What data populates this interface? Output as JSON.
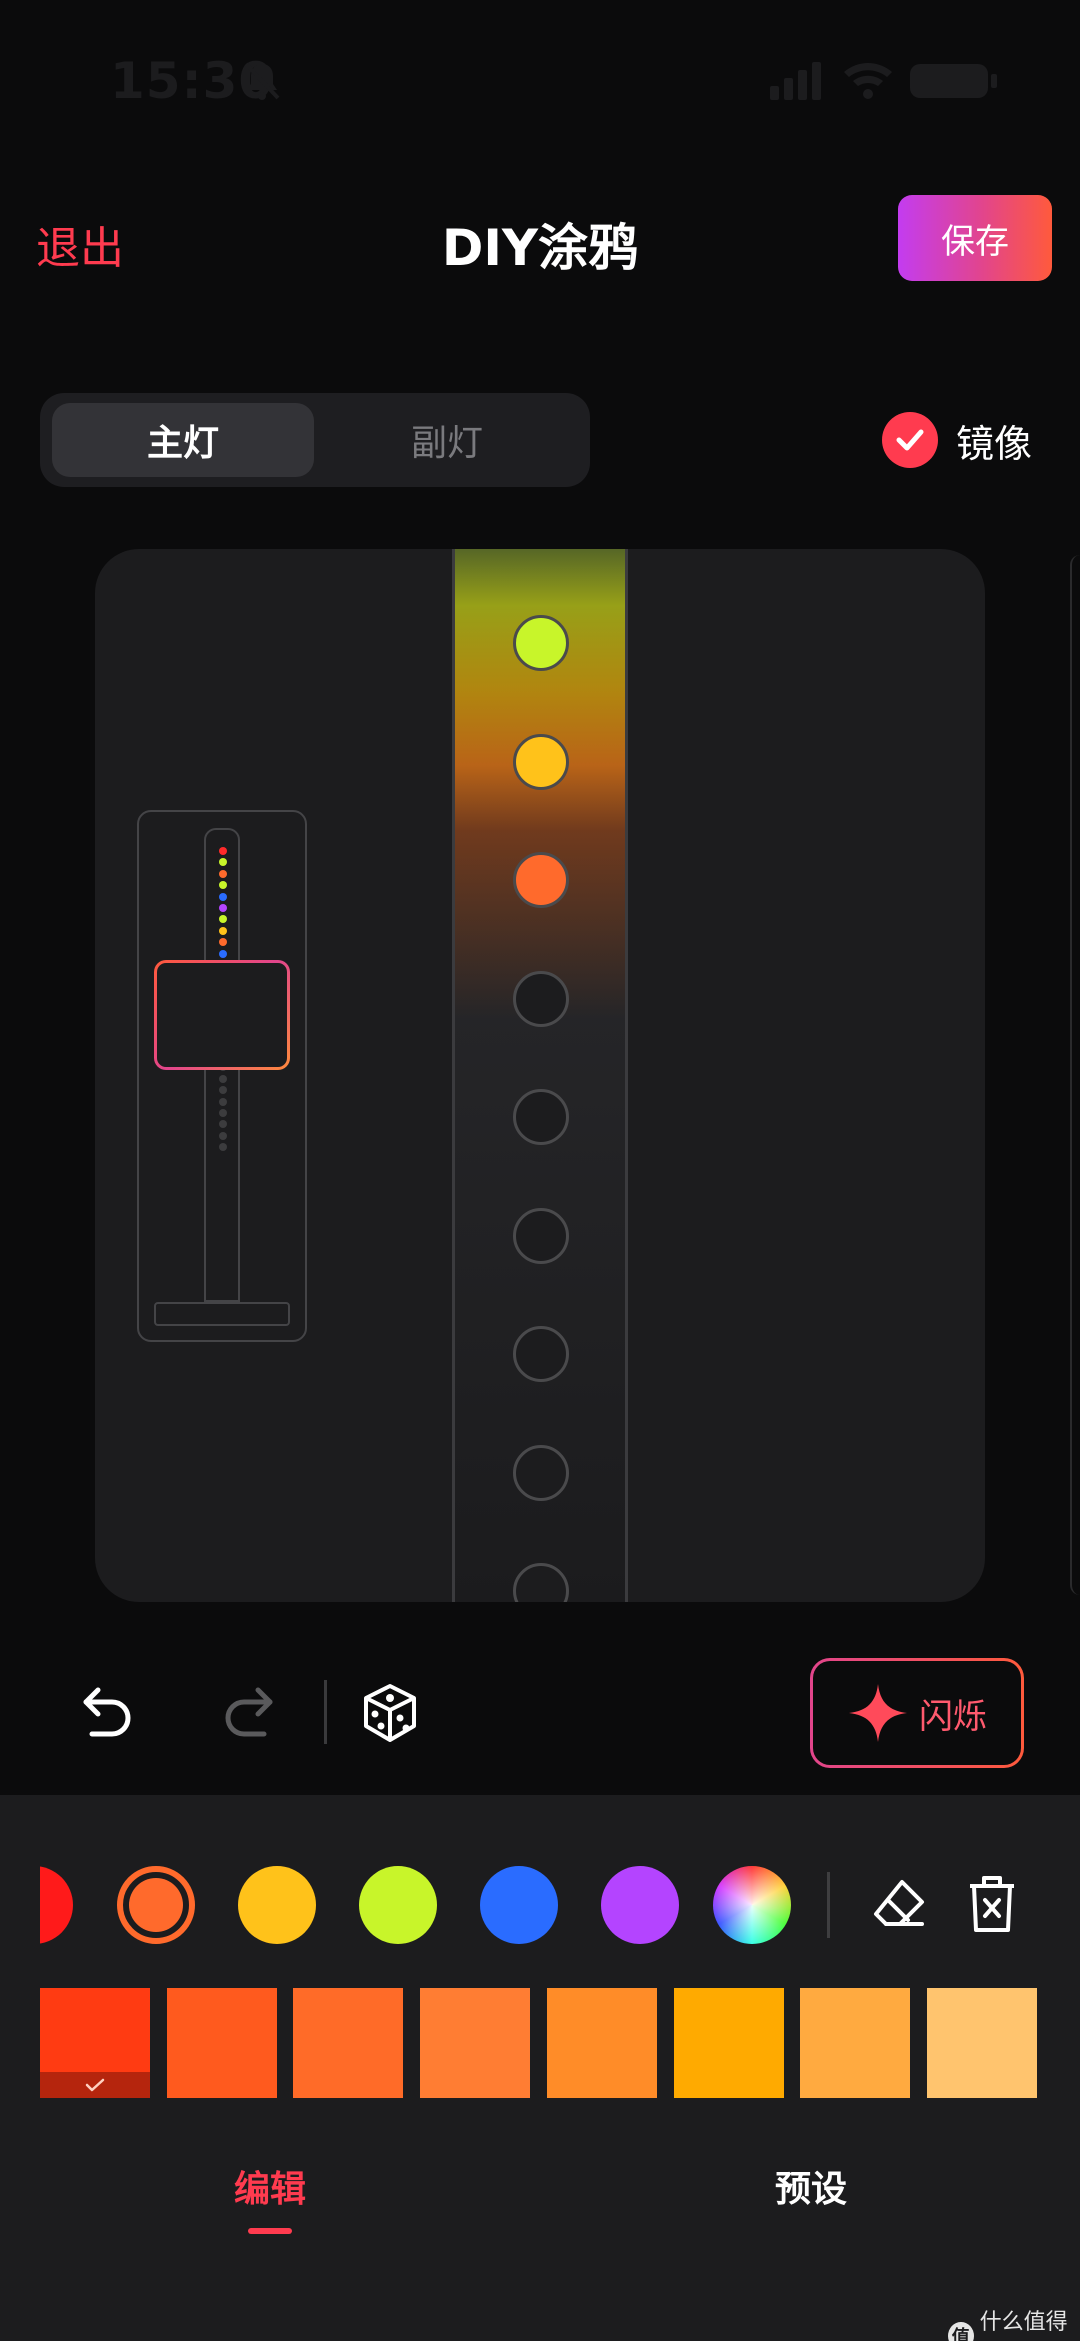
{
  "status_bar": {
    "time": "15:30"
  },
  "header": {
    "exit_label": "退出",
    "title": "DIY涂鸦",
    "save_label": "保存"
  },
  "segmented": {
    "active_label": "主灯",
    "inactive_label": "副灯"
  },
  "mirror": {
    "label": "镜像",
    "checked": true
  },
  "strip": {
    "led_colors": [
      "#c8f52a",
      "#ffc21a",
      "#ff6a2c",
      "#1c1c1e",
      "#1c1c1e",
      "#1c1c1e",
      "#1c1c1e",
      "#1c1c1e",
      "#1c1c1e"
    ]
  },
  "thumbnail": {
    "dot_colors": [
      "#ff2a2a",
      "#c8f52a",
      "#ff6a2c",
      "#c8f52a",
      "#2a6cff",
      "#b444ff",
      "#c8f52a",
      "#ffc21a",
      "#ff6a2c",
      "#2a6cff",
      "#c8f52a",
      "#ffc21a",
      "#ff6a2c"
    ],
    "total_dots": 27
  },
  "toolbar": {
    "flash_label": "闪烁"
  },
  "palette": {
    "colors": [
      "#ff1a1a",
      "#ff6a2c",
      "#ffc21a",
      "#c8f52a",
      "#2a6cff",
      "#b444ff"
    ],
    "selected": "#ff6a2c"
  },
  "shades": [
    "#ff3b12",
    "#ff5a1e",
    "#ff6b28",
    "#ff7d33",
    "#ff8c28",
    "#ffaa00",
    "#ffaa40",
    "#ffc46e"
  ],
  "tabs": {
    "edit_label": "编辑",
    "preset_label": "预设",
    "active": "edit"
  },
  "watermark": {
    "logo_text": "值",
    "text": "什么值得买"
  }
}
